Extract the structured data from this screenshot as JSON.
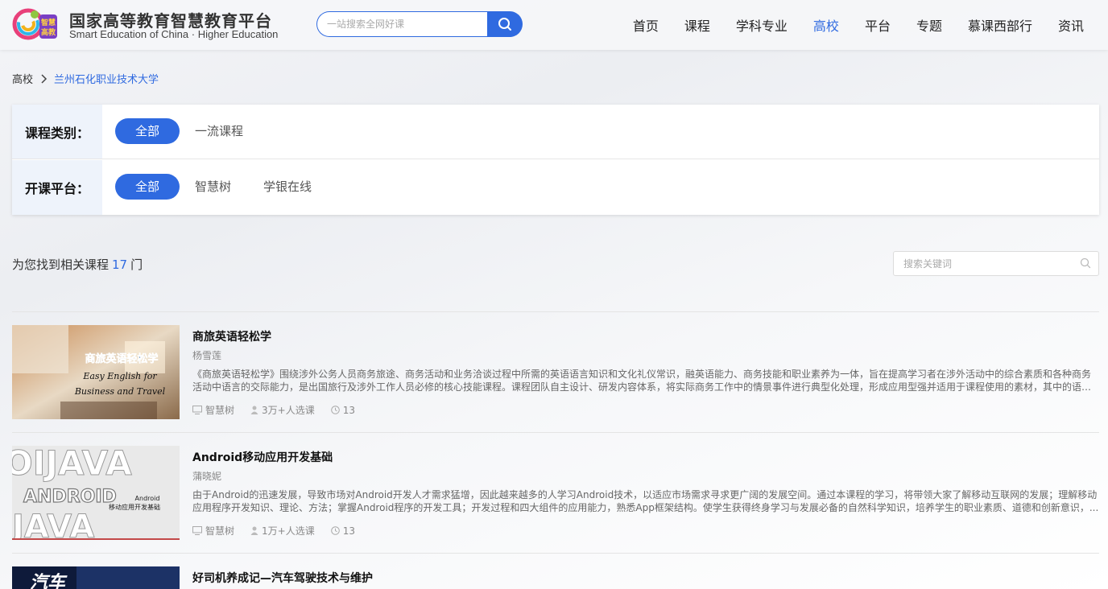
{
  "header": {
    "logo_cn": "国家高等教育智慧教育平台",
    "logo_en": "Smart Education of China · Higher Education",
    "logo_badge": "智慧高教",
    "search_placeholder": "一站搜索全网好课",
    "nav": [
      "首页",
      "课程",
      "学科专业",
      "高校",
      "平台",
      "专题",
      "慕课西部行",
      "资讯"
    ],
    "active_nav": "高校"
  },
  "breadcrumb": {
    "home": "高校",
    "current": "兰州石化职业技术大学"
  },
  "filters": {
    "category_label": "课程类别：",
    "category_options": [
      "全部",
      "一流课程"
    ],
    "platform_label": "开课平台：",
    "platform_options": [
      "全部",
      "智慧树",
      "学银在线"
    ]
  },
  "results": {
    "prefix": "为您找到相关课程",
    "count": "17",
    "suffix": "门",
    "keyword_placeholder": "搜索关键词"
  },
  "courses": [
    {
      "title": "商旅英语轻松学",
      "teacher": "杨雪莲",
      "desc": "《商旅英语轻松学》围绕涉外公务人员商务旅途、商务活动和业务洽谈过程中所需的英语语言知识和文化礼仪常识，融英语能力、商务技能和职业素养为一体，旨在提高学习者在涉外活动中的综合素质和各种商务活动中语言的交际能力，是出国旅行及涉外工作人员必修的核心技能课程。课程团队自主设计、研发内容体系，将实际商务工作中的情景事件进行典型化处理，形成应用型强并适用于课程使用的素材，其中的语言...",
      "platform": "智慧树",
      "learners": "3万+人选课",
      "sessions": "13",
      "thumb_title": "商旅英语轻松学",
      "thumb_sub1": "Easy English for",
      "thumb_sub2": "Business and Travel"
    },
    {
      "title": "Android移动应用开发基础",
      "teacher": "蒲晓妮",
      "desc": "由于Android的迅速发展，导致市场对Android开发人才需求猛增，因此越来越多的人学习Android技术，以适应市场需求寻求更广阔的发展空间。通过本课程的学习，将带领大家了解移动互联网的发展；理解移动应用程序开发知识、理论、方法；掌握Android程序的开发工具；开发过程和四大组件的应用能力，熟悉App框架结构。使学生获得终身学习与发展必备的自然科学知识，培养学生的职业素质、道德和创新意识，...",
      "platform": "智慧树",
      "learners": "1万+人选课",
      "sessions": "13",
      "thumb_big": "ANDROID",
      "thumb_small1": "Android",
      "thumb_small2": "移动应用开发基础"
    },
    {
      "title": "好司机养成记—汽车驾驶技术与维护",
      "thumb_title": "汽车"
    }
  ],
  "colors": {
    "accent": "#2f6ae0",
    "label_bg": "#eef3fb"
  }
}
